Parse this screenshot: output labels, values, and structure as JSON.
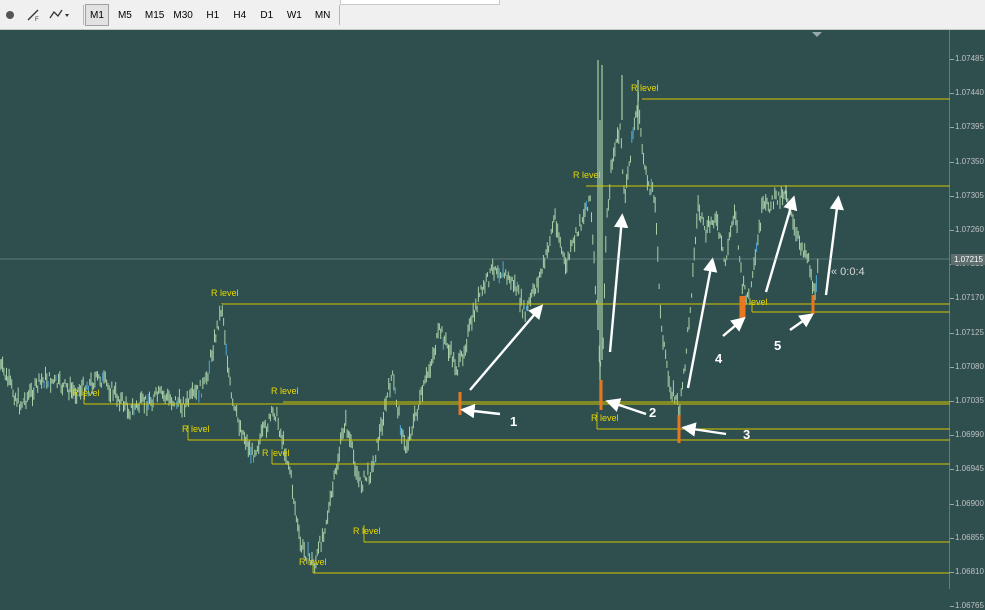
{
  "toolbar": {
    "timeframes": [
      "M1",
      "M5",
      "M15",
      "M30",
      "H1",
      "H4",
      "D1",
      "W1",
      "MN"
    ],
    "active_timeframe": "M1"
  },
  "chart": {
    "price_scale": [
      "1.07485",
      "1.07440",
      "1.07395",
      "1.07350",
      "1.07305",
      "1.07260",
      "1.07215",
      "1.07170",
      "1.07125",
      "1.07080",
      "1.07035",
      "1.06990",
      "1.06945",
      "1.06900",
      "1.06855",
      "1.06810",
      "1.06765"
    ],
    "current_price": "1.07215",
    "countdown": "« 0:0:4",
    "level_label": "R level",
    "annotation_numbers": [
      "1",
      "2",
      "3",
      "4",
      "5"
    ],
    "colors": {
      "background": "#2f4f4f",
      "levels": "#d4c400",
      "label": "#e8d800",
      "candles": "#a8d0a8",
      "marker": "#e87722",
      "arrow": "#ffffff"
    }
  }
}
